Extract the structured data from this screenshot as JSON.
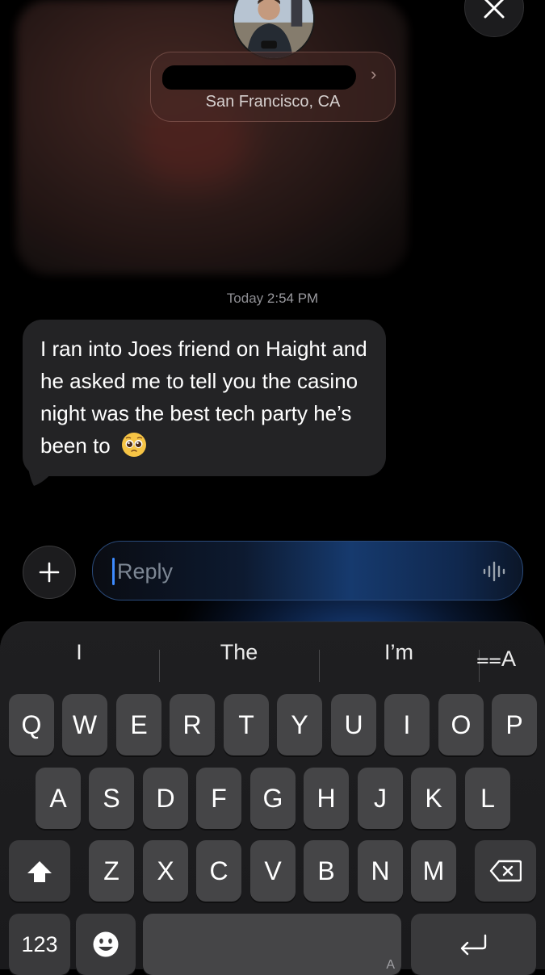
{
  "contact": {
    "location": "San Francisco, CA",
    "chevron": "›"
  },
  "conversation": {
    "timestamp_day": "Today",
    "timestamp_time": "2:54 PM",
    "message": "I ran into Joes friend on Haight and he asked me to tell you the casino night was the best tech party he’s been to",
    "message_emoji": "pleading-face-icon"
  },
  "composer": {
    "placeholder": "Reply",
    "plus_icon": "plus-icon",
    "mic_icon": "dictation-waveform-icon"
  },
  "keyboard": {
    "suggestions": [
      "I",
      "The",
      "I’m"
    ],
    "format_label": "⩵A",
    "row1": [
      "Q",
      "W",
      "E",
      "R",
      "T",
      "Y",
      "U",
      "I",
      "O",
      "P"
    ],
    "row2": [
      "A",
      "S",
      "D",
      "F",
      "G",
      "H",
      "J",
      "K",
      "L"
    ],
    "row3": [
      "Z",
      "X",
      "C",
      "V",
      "B",
      "N",
      "M"
    ],
    "numbers_label": "123",
    "space_label": "A",
    "accent_color": "#3d8bff"
  }
}
